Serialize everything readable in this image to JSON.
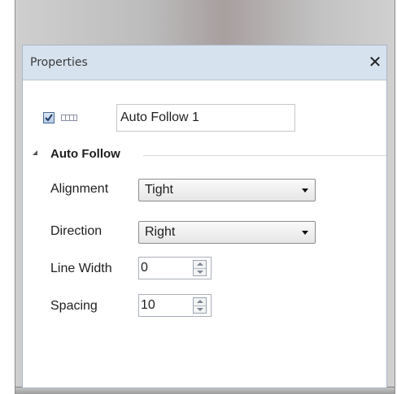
{
  "panel": {
    "title": "Properties",
    "close_glyph": "✕"
  },
  "item": {
    "checked": true,
    "name": "Auto Follow 1"
  },
  "section": {
    "label": "Auto Follow",
    "expanded": true
  },
  "properties": {
    "alignment": {
      "label": "Alignment",
      "value": "Tight"
    },
    "direction": {
      "label": "Direction",
      "value": "Right"
    },
    "line_width": {
      "label": "Line Width",
      "value": "0"
    },
    "spacing": {
      "label": "Spacing",
      "value": "10"
    }
  },
  "colors": {
    "titlebar": "#d6e2ee",
    "accent": "#4a6a96"
  }
}
